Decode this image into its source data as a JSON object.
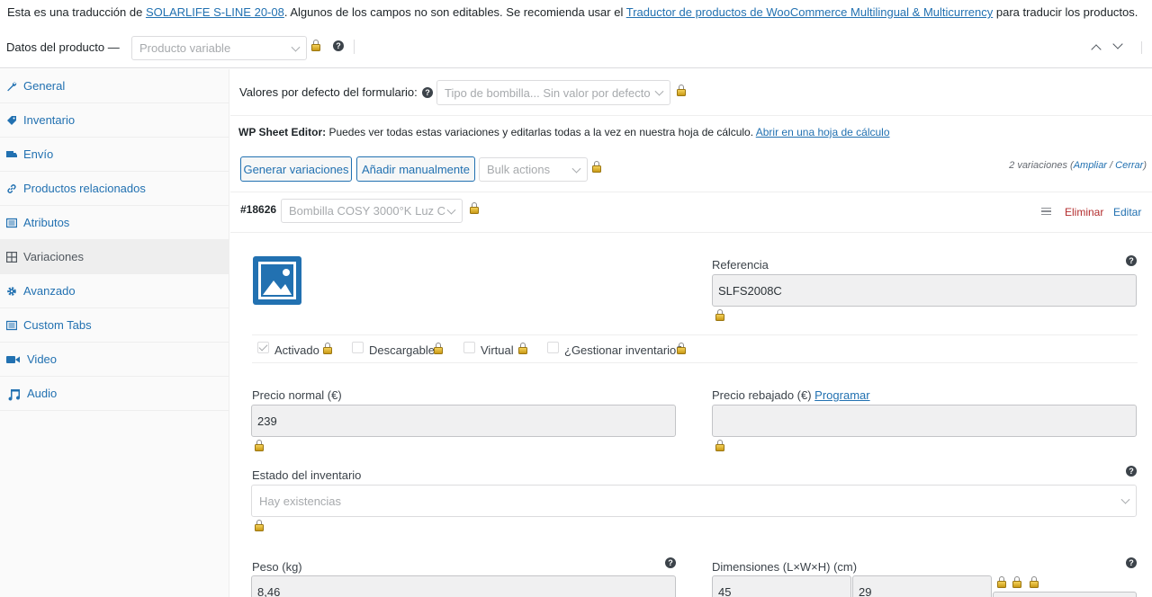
{
  "notice": {
    "prefix": "Esta es una traducción de ",
    "product_link": "SOLARLIFE S-LINE 20-08",
    "middle": ". Algunos de los campos no son editables. Se recomienda usar el ",
    "translator_link": "Traductor de productos de WooCommerce Multilingual & Multicurrency",
    "suffix": " para traducir los productos."
  },
  "header": {
    "label": "Datos del producto —",
    "product_type": "Producto variable"
  },
  "sidebar": {
    "items": [
      {
        "label": "General",
        "icon": "wrench-icon"
      },
      {
        "label": "Inventario",
        "icon": "tag-icon"
      },
      {
        "label": "Envío",
        "icon": "truck-icon"
      },
      {
        "label": "Productos relacionados",
        "icon": "link-icon"
      },
      {
        "label": "Atributos",
        "icon": "list-icon"
      },
      {
        "label": "Variaciones",
        "icon": "grid-icon"
      },
      {
        "label": "Avanzado",
        "icon": "gear-icon"
      },
      {
        "label": "Custom Tabs",
        "icon": "list-icon"
      },
      {
        "label": "Video",
        "icon": "video-icon"
      },
      {
        "label": "Audio",
        "icon": "music-icon"
      }
    ],
    "active": "Variaciones"
  },
  "defaults": {
    "label": "Valores por defecto del formulario:",
    "placeholder": "Tipo de bombilla... Sin valor por defecto"
  },
  "sheet_editor": {
    "bold": "WP Sheet Editor:",
    "text": " Puedes ver todas estas variaciones y editarlas todas a la vez en nuestra hoja de cálculo. ",
    "link": "Abrir en una hoja de cálculo"
  },
  "toolbar": {
    "generate": "Generar variaciones",
    "add_manual": "Añadir manualmente",
    "bulk": "Bulk actions",
    "count": "2 variaciones (",
    "expand": "Ampliar",
    "sep": " / ",
    "close": "Cerrar",
    "end": ")"
  },
  "variation": {
    "id": "#18626",
    "attribute": "Bombilla COSY 3000°K Luz C",
    "delete": "Eliminar",
    "edit": "Editar",
    "sku_label": "Referencia",
    "sku": "SLFS2008C",
    "enabled": "Activado",
    "downloadable": "Descargable",
    "virtual": "Virtual",
    "manage_stock": "¿Gestionar inventario?",
    "regular_price_label": "Precio normal (€)",
    "regular_price": "239",
    "sale_price_label": "Precio rebajado (€) ",
    "schedule": "Programar",
    "sale_price": "",
    "stock_status_label": "Estado del inventario",
    "stock_status": "Hay existencias",
    "weight_label": "Peso (kg)",
    "weight": "8,46",
    "dimensions_label": "Dimensiones (L×W×H) (cm)",
    "length": "45",
    "width": "29"
  },
  "colors": {
    "link": "#2271b1",
    "delete": "#b32d2e",
    "lock": "#d4a81c"
  }
}
